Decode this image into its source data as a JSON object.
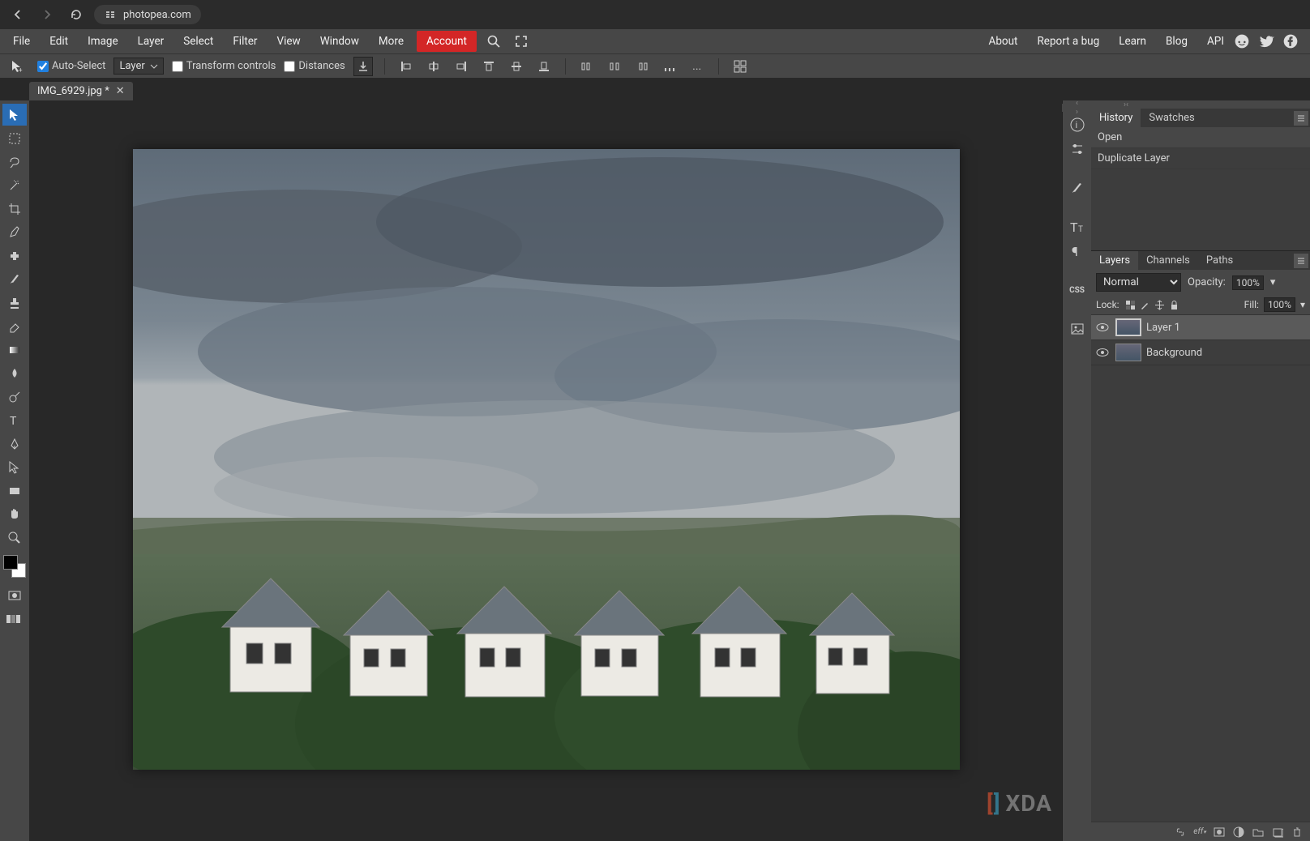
{
  "browser": {
    "url": "photopea.com"
  },
  "menu": {
    "items": [
      "File",
      "Edit",
      "Image",
      "Layer",
      "Select",
      "Filter",
      "View",
      "Window",
      "More"
    ],
    "account": "Account",
    "right_links": [
      "About",
      "Report a bug",
      "Learn",
      "Blog",
      "API"
    ]
  },
  "options": {
    "auto_select": "Auto-Select",
    "layer_select": "Layer",
    "transform_controls": "Transform controls",
    "distances": "Distances"
  },
  "doc_tab": {
    "name": "IMG_6929.jpg *"
  },
  "history_panel": {
    "tabs": [
      "History",
      "Swatches"
    ],
    "items": [
      "Open",
      "Duplicate Layer"
    ]
  },
  "layers_panel": {
    "tabs": [
      "Layers",
      "Channels",
      "Paths"
    ],
    "blend_mode": "Normal",
    "opacity_label": "Opacity:",
    "opacity_value": "100%",
    "lock_label": "Lock:",
    "fill_label": "Fill:",
    "fill_value": "100%",
    "layers": [
      {
        "name": "Layer 1",
        "active": true,
        "visible": true
      },
      {
        "name": "Background",
        "active": false,
        "visible": true
      }
    ]
  },
  "watermark": "XDA"
}
